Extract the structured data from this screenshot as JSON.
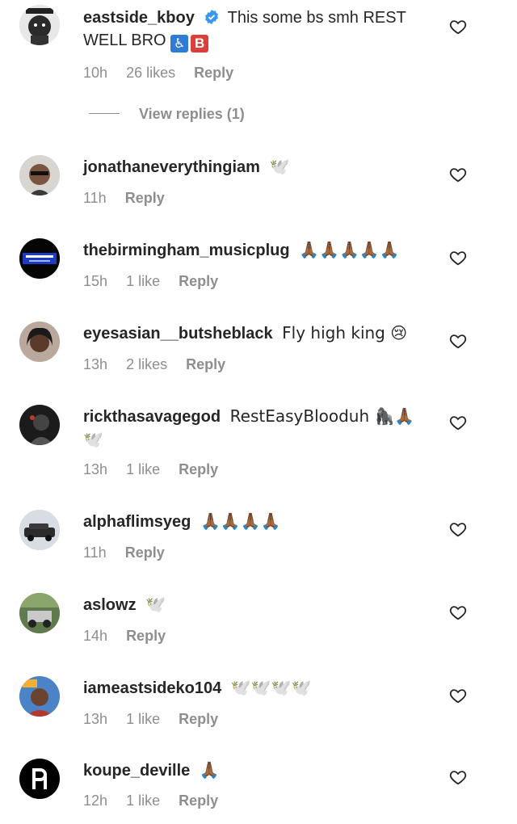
{
  "comments": [
    {
      "username": "eastside_kboy",
      "verified": true,
      "text": "This some bs smh REST WELL BRO",
      "emoji": "♿🅱️",
      "time": "10h",
      "likes": "26 likes",
      "reply": "Reply"
    },
    {
      "username": "jonathaneverythingiam",
      "text": "🕊️",
      "time": "11h",
      "likes": "",
      "reply": "Reply"
    },
    {
      "username": "thebirmingham_musicplug",
      "text": "🙏🏾🙏🏾🙏🏾🙏🏾🙏🏾",
      "time": "15h",
      "likes": "1 like",
      "reply": "Reply"
    },
    {
      "username": "eyesasian__butsheblack",
      "text": "Fly high king 😢",
      "time": "13h",
      "likes": "2 likes",
      "reply": "Reply"
    },
    {
      "username": "rickthasavagegod",
      "text": "RestEasyBlooduh 🦍🙏🏾 🕊️",
      "time": "13h",
      "likes": "1 like",
      "reply": "Reply"
    },
    {
      "username": "alphaflimsyeg",
      "text": "🙏🏾🙏🏾🙏🏾🙏🏾",
      "time": "11h",
      "likes": "",
      "reply": "Reply"
    },
    {
      "username": "aslowz",
      "text": "🕊️",
      "time": "14h",
      "likes": "",
      "reply": "Reply"
    },
    {
      "username": "iameastsideko104",
      "text": "🕊️🕊️🕊️🕊️",
      "time": "13h",
      "likes": "1 like",
      "reply": "Reply"
    },
    {
      "username": "koupe_deville",
      "text": "🙏🏾",
      "time": "12h",
      "likes": "1 like",
      "reply": "Reply"
    }
  ],
  "view_replies": "View replies (1)",
  "colors": {
    "text": "#262626",
    "meta": "#8e8e8e",
    "verified": "#3897f0"
  }
}
